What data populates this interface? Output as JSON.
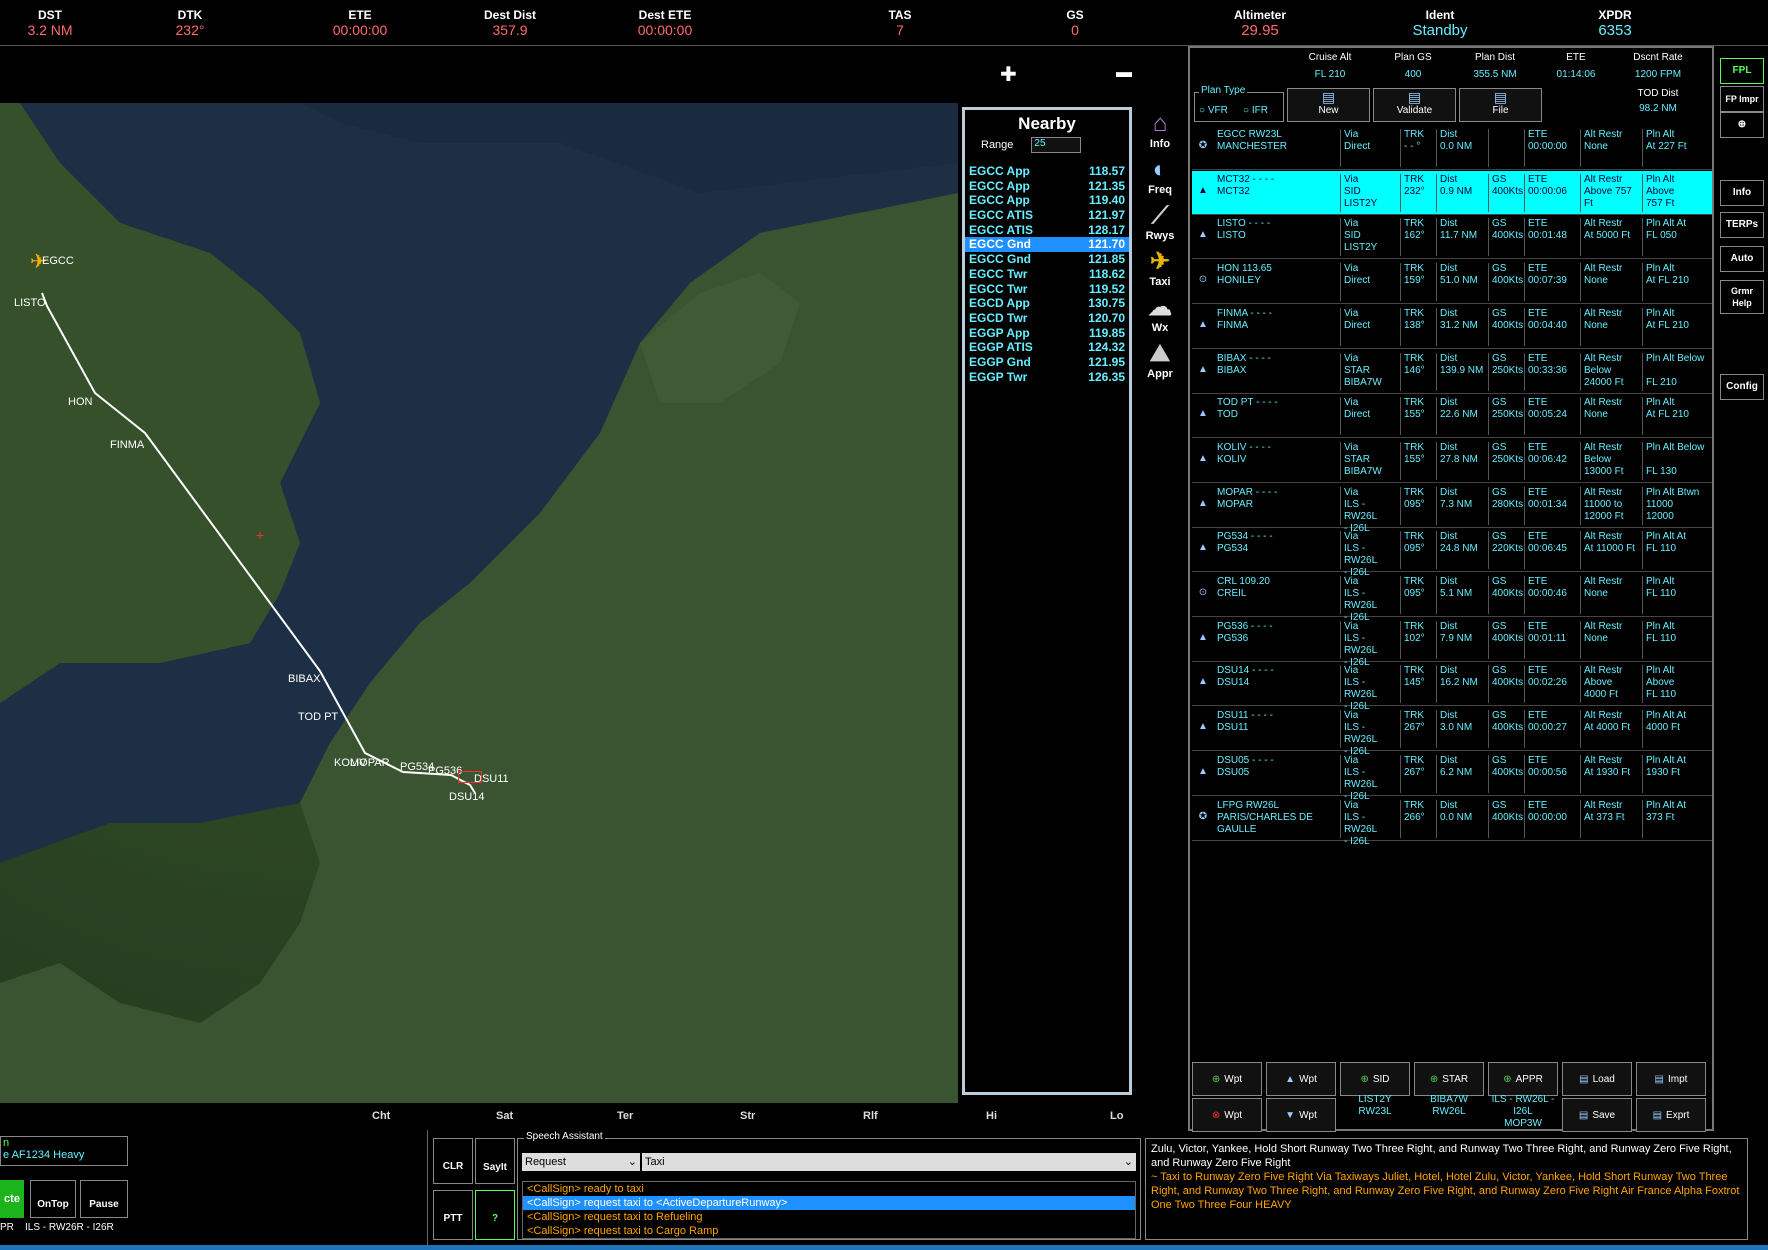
{
  "header": [
    {
      "label": "DST",
      "value": "3.2 NM"
    },
    {
      "label": "DTK",
      "value": "232°"
    },
    {
      "label": "ETE",
      "value": "00:00:00"
    },
    {
      "label": "Dest Dist",
      "value": "357.9"
    },
    {
      "label": "Dest ETE",
      "value": "00:00:00"
    },
    {
      "label": "TAS",
      "value": "7"
    },
    {
      "label": "GS",
      "value": "0"
    },
    {
      "label": "Altimeter",
      "value": "29.95"
    },
    {
      "label": "Ident",
      "value": "Standby"
    },
    {
      "label": "XPDR",
      "value": "6353"
    }
  ],
  "map": {
    "zoom_in": "✚",
    "zoom_out": "▬",
    "aircraft_label": "EGCC",
    "waypoints": [
      "LISTO",
      "HON",
      "FINMA",
      "BIBAX",
      "TOD PT",
      "KOLIV",
      "MOPAR",
      "PG534",
      "PG536",
      "DSU14",
      "DSU11"
    ],
    "tabs": [
      "Cht",
      "Sat",
      "Ter",
      "Str",
      "Rlf",
      "Hi",
      "Lo"
    ]
  },
  "nearby": {
    "title": "Nearby",
    "range_label": "Range",
    "range_value": "25",
    "rows": [
      {
        "name": "EGCC App",
        "freq": "118.57"
      },
      {
        "name": "EGCC App",
        "freq": "121.35"
      },
      {
        "name": "EGCC App",
        "freq": "119.40"
      },
      {
        "name": "EGCC ATIS",
        "freq": "121.97"
      },
      {
        "name": "EGCC ATIS",
        "freq": "128.17"
      },
      {
        "name": "EGCC Gnd",
        "freq": "121.70"
      },
      {
        "name": "EGCC Gnd",
        "freq": "121.85"
      },
      {
        "name": "EGCC Twr",
        "freq": "118.62"
      },
      {
        "name": "EGCC Twr",
        "freq": "119.52"
      },
      {
        "name": "EGCD App",
        "freq": "130.75"
      },
      {
        "name": "EGCD Twr",
        "freq": "120.70"
      },
      {
        "name": "EGGP App",
        "freq": "119.85"
      },
      {
        "name": "EGGP ATIS",
        "freq": "124.32"
      },
      {
        "name": "EGGP Gnd",
        "freq": "121.95"
      },
      {
        "name": "EGGP Twr",
        "freq": "126.35"
      }
    ],
    "selected_index": 5
  },
  "side_icons": [
    {
      "label": "Info",
      "icon": "info-icon"
    },
    {
      "label": "Freq",
      "icon": "freq-icon"
    },
    {
      "label": "Rwys",
      "icon": "runway-icon"
    },
    {
      "label": "Taxi",
      "icon": "taxi-icon"
    },
    {
      "label": "Wx",
      "icon": "weather-icon"
    },
    {
      "label": "Appr",
      "icon": "approach-icon"
    }
  ],
  "plan_summary": [
    {
      "label": "Cruise Alt",
      "value": "FL 210"
    },
    {
      "label": "Plan GS",
      "value": "400"
    },
    {
      "label": "Plan Dist",
      "value": "355.5 NM"
    },
    {
      "label": "ETE",
      "value": "01:14:06"
    },
    {
      "label": "Dscnt Rate",
      "value": "1200 FPM"
    }
  ],
  "tod_label": "TOD Dist",
  "tod_value": "98.2 NM",
  "plan_type": {
    "label": "Plan Type",
    "vfr": "VFR",
    "ifr": "IFR"
  },
  "plan_buttons": [
    "New",
    "Validate",
    "File"
  ],
  "flight_plan": [
    {
      "icon": "airport-icon",
      "id": "EGCC  RW23L",
      "name": "MANCHESTER",
      "via": "Via\nDirect",
      "trk": "TRK\n- - °",
      "dist": "Dist\n0.0 NM",
      "gs": "",
      "ete": "ETE\n00:00:00",
      "restr": "Alt Restr\nNone",
      "pln": "Pln Alt\nAt 227 Ft"
    },
    {
      "icon": "triangle-icon",
      "id": "MCT32   - - - -",
      "name": "MCT32",
      "via": "Via\nSID\nLIST2Y",
      "trk": "TRK\n232°",
      "dist": "Dist\n0.9 NM",
      "gs": "GS\n400Kts",
      "ete": "ETE\n00:00:06",
      "restr": "Alt Restr\nAbove 757\nFt",
      "pln": "Pln Alt\nAbove\n757 Ft"
    },
    {
      "icon": "triangle-icon",
      "id": "LISTO   - - - -",
      "name": "LISTO",
      "via": "Via\nSID\nLIST2Y",
      "trk": "TRK\n162°",
      "dist": "Dist\n11.7 NM",
      "gs": "GS\n400Kts",
      "ete": "ETE\n00:01:48",
      "restr": "Alt Restr\nAt 5000 Ft",
      "pln": "Pln Alt At\nFL 050"
    },
    {
      "icon": "vor-icon",
      "id": "HON   113.65",
      "name": "HONILEY",
      "via": "Via\nDirect",
      "trk": "TRK\n159°",
      "dist": "Dist\n51.0 NM",
      "gs": "GS\n400Kts",
      "ete": "ETE\n00:07:39",
      "restr": "Alt Restr\nNone",
      "pln": "Pln Alt\nAt FL 210"
    },
    {
      "icon": "triangle-icon",
      "id": "FINMA   - - - -",
      "name": "FINMA",
      "via": "Via\nDirect",
      "trk": "TRK\n138°",
      "dist": "Dist\n31.2 NM",
      "gs": "GS\n400Kts",
      "ete": "ETE\n00:04:40",
      "restr": "Alt Restr\nNone",
      "pln": "Pln Alt\nAt FL 210"
    },
    {
      "icon": "triangle-icon",
      "id": "BIBAX   - - - -",
      "name": "BIBAX",
      "via": "Via\nSTAR\nBIBA7W",
      "trk": "TRK\n146°",
      "dist": "Dist\n139.9 NM",
      "gs": "GS\n250Kts",
      "ete": "ETE\n00:33:36",
      "restr": "Alt Restr\nBelow\n24000 Ft",
      "pln": "Pln Alt Below\n\nFL 210"
    },
    {
      "icon": "triangle-icon",
      "id": "TOD PT   - - - -",
      "name": "TOD",
      "via": "Via\nDirect",
      "trk": "TRK\n155°",
      "dist": "Dist\n22.6 NM",
      "gs": "GS\n250Kts",
      "ete": "ETE\n00:05:24",
      "restr": "Alt Restr\nNone",
      "pln": "Pln Alt\nAt FL 210"
    },
    {
      "icon": "triangle-icon",
      "id": "KOLIV   - - - -",
      "name": "KOLIV",
      "via": "Via\nSTAR\nBIBA7W",
      "trk": "TRK\n155°",
      "dist": "Dist\n27.8 NM",
      "gs": "GS\n250Kts",
      "ete": "ETE\n00:06:42",
      "restr": "Alt Restr\nBelow\n13000 Ft",
      "pln": "Pln Alt Below\n\nFL 130"
    },
    {
      "icon": "triangle-icon",
      "id": "MOPAR   - - - -",
      "name": "MOPAR",
      "via": "Via\nILS - RW26L\n- I26L",
      "trk": "TRK\n095°",
      "dist": "Dist\n7.3 NM",
      "gs": "GS\n280Kts",
      "ete": "ETE\n00:01:34",
      "restr": "Alt Restr\n11000 to\n12000 Ft",
      "pln": "Pln Alt Btwn\n11000\n12000"
    },
    {
      "icon": "triangle-icon",
      "id": "PG534   - - - -",
      "name": "PG534",
      "via": "Via\nILS - RW26L\n- I26L",
      "trk": "TRK\n095°",
      "dist": "Dist\n24.8 NM",
      "gs": "GS\n220Kts",
      "ete": "ETE\n00:06:45",
      "restr": "Alt Restr\nAt 11000 Ft",
      "pln": "Pln Alt At\nFL 110"
    },
    {
      "icon": "vor-icon",
      "id": "CRL   109.20",
      "name": "CREIL",
      "via": "Via\nILS - RW26L\n- I26L",
      "trk": "TRK\n095°",
      "dist": "Dist\n5.1 NM",
      "gs": "GS\n400Kts",
      "ete": "ETE\n00:00:46",
      "restr": "Alt Restr\nNone",
      "pln": "Pln Alt\nFL 110"
    },
    {
      "icon": "triangle-icon",
      "id": "PG536   - - - -",
      "name": "PG536",
      "via": "Via\nILS - RW26L\n- I26L",
      "trk": "TRK\n102°",
      "dist": "Dist\n7.9 NM",
      "gs": "GS\n400Kts",
      "ete": "ETE\n00:01:11",
      "restr": "Alt Restr\nNone",
      "pln": "Pln Alt\nFL 110"
    },
    {
      "icon": "triangle-icon",
      "id": "DSU14   - - - -",
      "name": "DSU14",
      "via": "Via\nILS - RW26L\n- I26L",
      "trk": "TRK\n145°",
      "dist": "Dist\n16.2 NM",
      "gs": "GS\n400Kts",
      "ete": "ETE\n00:02:26",
      "restr": "Alt Restr\nAbove\n4000 Ft",
      "pln": "Pln Alt\nAbove\nFL 110"
    },
    {
      "icon": "triangle-icon",
      "id": "DSU11   - - - -",
      "name": "DSU11",
      "via": "Via\nILS - RW26L\n- I26L",
      "trk": "TRK\n267°",
      "dist": "Dist\n3.0 NM",
      "gs": "GS\n400Kts",
      "ete": "ETE\n00:00:27",
      "restr": "Alt Restr\nAt 4000 Ft",
      "pln": "Pln Alt At\n4000 Ft"
    },
    {
      "icon": "triangle-icon",
      "id": "DSU05   - - - -",
      "name": "DSU05",
      "via": "Via\nILS - RW26L\n- I26L",
      "trk": "TRK\n267°",
      "dist": "Dist\n6.2 NM",
      "gs": "GS\n400Kts",
      "ete": "ETE\n00:00:56",
      "restr": "Alt Restr\nAt 1930 Ft",
      "pln": "Pln Alt At\n1930 Ft"
    },
    {
      "icon": "airport-icon",
      "id": "LFPG  RW26L",
      "name": "PARIS/CHARLES DE\nGAULLE",
      "via": "Via\nILS - RW26L\n- I26L",
      "trk": "TRK\n266°",
      "dist": "Dist\n0.0 NM",
      "gs": "GS\n400Kts",
      "ete": "ETE\n00:00:00",
      "restr": "Alt Restr\nAt 373 Ft",
      "pln": "Pln Alt At\n373 Ft"
    }
  ],
  "selected_row": 1,
  "right_buttons": [
    "FPL",
    "FP Impr",
    "Info",
    "TERPs",
    "Auto",
    "Grmr\nHelp",
    "Config"
  ],
  "bottom_buttons_row1": [
    "Wpt",
    "Wpt",
    "SID",
    "STAR",
    "APPR",
    "Load",
    "Impt"
  ],
  "bottom_buttons_row2": [
    "Wpt",
    "Wpt",
    "Save",
    "Exprt"
  ],
  "procedures": [
    {
      "line1": "LIST2Y",
      "line2": "RW23L"
    },
    {
      "line1": "BIBA7W",
      "line2": "RW26L"
    },
    {
      "line1": "ILS - RW26L -",
      "line2": "I26L",
      "line3": "MOP3W"
    }
  ],
  "left_panel": {
    "line1": "n",
    "line2": "e AF1234 Heavy",
    "btn_green": "cte",
    "btn_ontop": "OnTop",
    "btn_pause": "Pause",
    "status": "PR    ILS - RW26R - I26R"
  },
  "speech": {
    "title": "Speech Assistant",
    "request_value": "Request",
    "taxi_value": "Taxi",
    "clr": "CLR",
    "sayit": "SayIt",
    "ptt": "PTT",
    "help": "?",
    "lines": [
      "<CallSign> ready to taxi",
      "<CallSign> request taxi to <ActiveDepartureRunway>",
      "<CallSign> request taxi to Refueling",
      "<CallSign> request taxi to Cargo Ramp"
    ],
    "selected": 1
  },
  "transcript": {
    "line1": "Zulu, Victor, Yankee,  Hold Short Runway Two Three Right, and Runway Two Three Right, and Runway Zero Five Right, and Runway Zero Five Right",
    "line2": "~ Taxi to Runway Zero Five Right Via Taxiways Juliet, Hotel, Hotel Zulu, Victor, Yankee,  Hold Short Runway Two Three Right, and Runway Two Three Right, and Runway Zero Five Right, and Runway Zero Five Right Air France Alpha Foxtrot One Two Three Four HEAVY"
  }
}
